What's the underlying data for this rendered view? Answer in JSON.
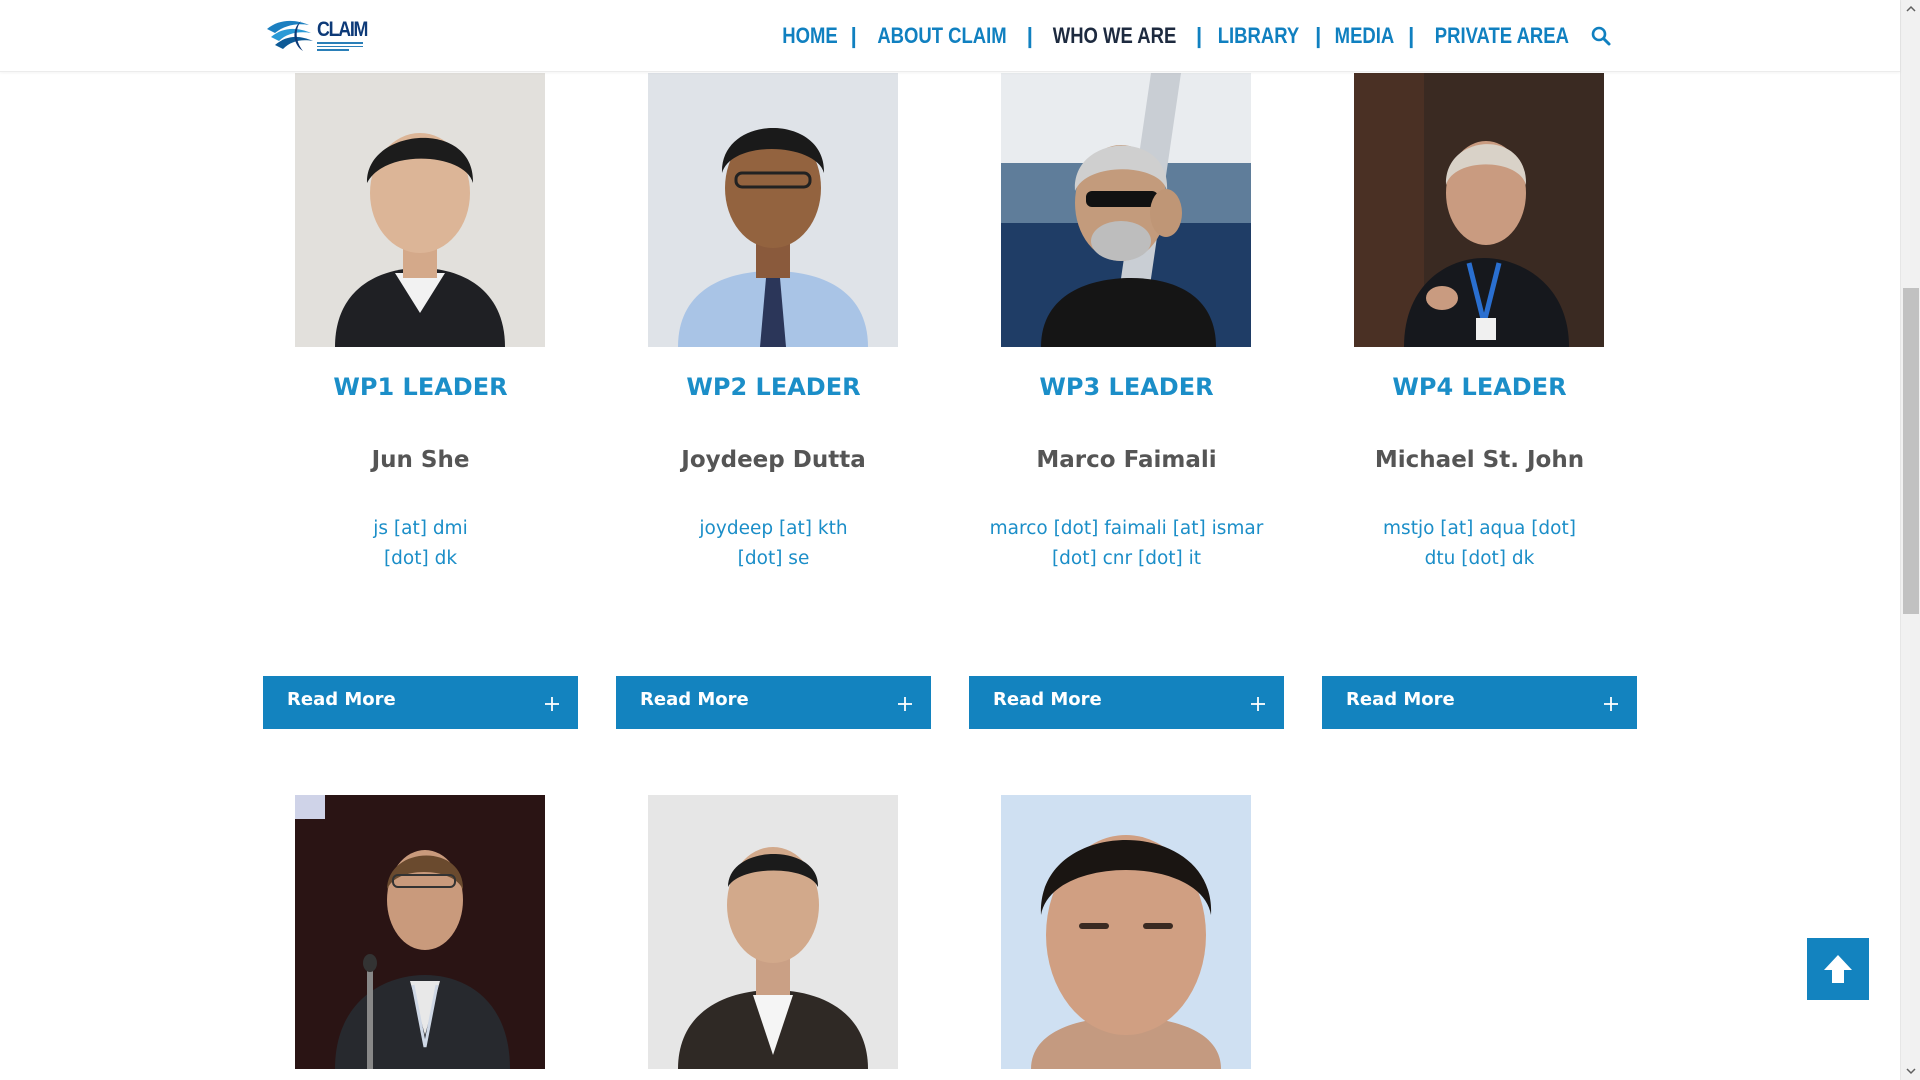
{
  "header": {
    "logo_text": "CLAIM",
    "nav": [
      {
        "label": "HOME"
      },
      {
        "label": "ABOUT CLAIM"
      },
      {
        "label": "WHO WE ARE",
        "active": true
      },
      {
        "label": "LIBRARY"
      },
      {
        "label": "MEDIA"
      },
      {
        "label": "PRIVATE AREA"
      }
    ],
    "search_icon": "search-icon"
  },
  "leaders": [
    {
      "role": "WP1 LEADER",
      "name": "Jun She",
      "email_line1": "js [at] dmi",
      "email_line2": "[dot] dk",
      "button": "Read More"
    },
    {
      "role": "WP2 LEADER",
      "name": "Joydeep Dutta",
      "email_line1": "joydeep [at] kth",
      "email_line2": "[dot] se",
      "button": "Read More"
    },
    {
      "role": "WP3 LEADER",
      "name": "Marco Faimali",
      "email_line1": "marco [dot] faimali [at] ismar",
      "email_line2": "[dot] cnr [dot] it",
      "button": "Read More"
    },
    {
      "role": "WP4 LEADER",
      "name": "Michael St. John",
      "email_line1": "mstjo [at] aqua [dot]",
      "email_line2": "dtu [dot] dk",
      "button": "Read More"
    }
  ],
  "colors": {
    "accent": "#1383bf",
    "link": "#1b8ec8",
    "nav_active": "#1d2a3f",
    "name": "#555555"
  },
  "back_to_top_icon": "arrow-up-icon"
}
